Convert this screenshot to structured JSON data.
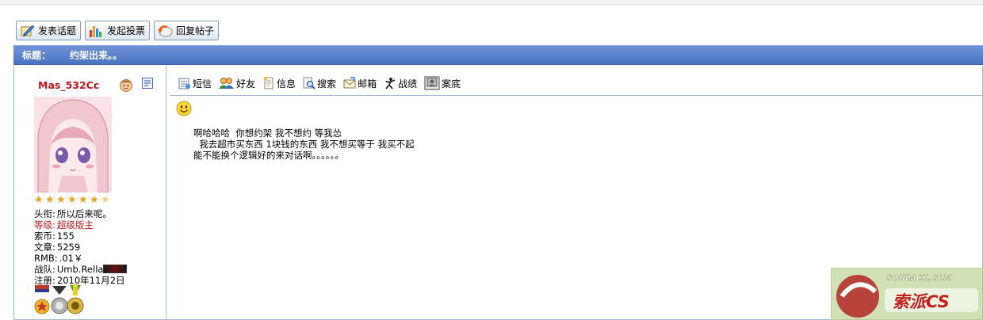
{
  "actions": [
    {
      "label": "发表话题",
      "icon": "new-topic-icon"
    },
    {
      "label": "发起投票",
      "icon": "poll-chart-icon"
    },
    {
      "label": "回复帖子",
      "icon": "reply-icon"
    }
  ],
  "thread": {
    "title_label": "标题：",
    "title": "约架出来。。"
  },
  "author": {
    "username": "Mas_532Cc",
    "stars": 7,
    "info": [
      {
        "key": "头衔:",
        "value": "所以后来呢。",
        "style": "normal"
      },
      {
        "key": "等级:",
        "value": "超级版主",
        "style": "red"
      },
      {
        "key": "索币:",
        "value": "155",
        "style": "normal"
      },
      {
        "key": "文章:",
        "value": "5259",
        "style": "normal"
      },
      {
        "key": "RMB:",
        "value": ".01￥",
        "style": "normal"
      },
      {
        "key": "战队:",
        "value": "Umb.Rella",
        "style": "normal"
      },
      {
        "key": "注册:",
        "value": "2010年11月2日",
        "style": "normal"
      }
    ]
  },
  "tools": [
    {
      "label": "短信",
      "icon": "message-icon"
    },
    {
      "label": "好友",
      "icon": "friends-icon"
    },
    {
      "label": "信息",
      "icon": "info-icon"
    },
    {
      "label": "搜索",
      "icon": "search-icon"
    },
    {
      "label": "邮箱",
      "icon": "mailbox-icon"
    },
    {
      "label": "战绩",
      "icon": "record-icon"
    },
    {
      "label": "案底",
      "icon": "file-icon"
    }
  ],
  "post": {
    "lines": [
      "啊哈哈哈  你想约架 我不想约 等我怂",
      "  我去超市买东西 1块钱的东西 我不想买等于 我买不起",
      "能不能换个逻辑好的来对话啊。。。。。。"
    ]
  },
  "watermark": {
    "text": "SOUPACK.COM",
    "brand": "索派CS"
  }
}
